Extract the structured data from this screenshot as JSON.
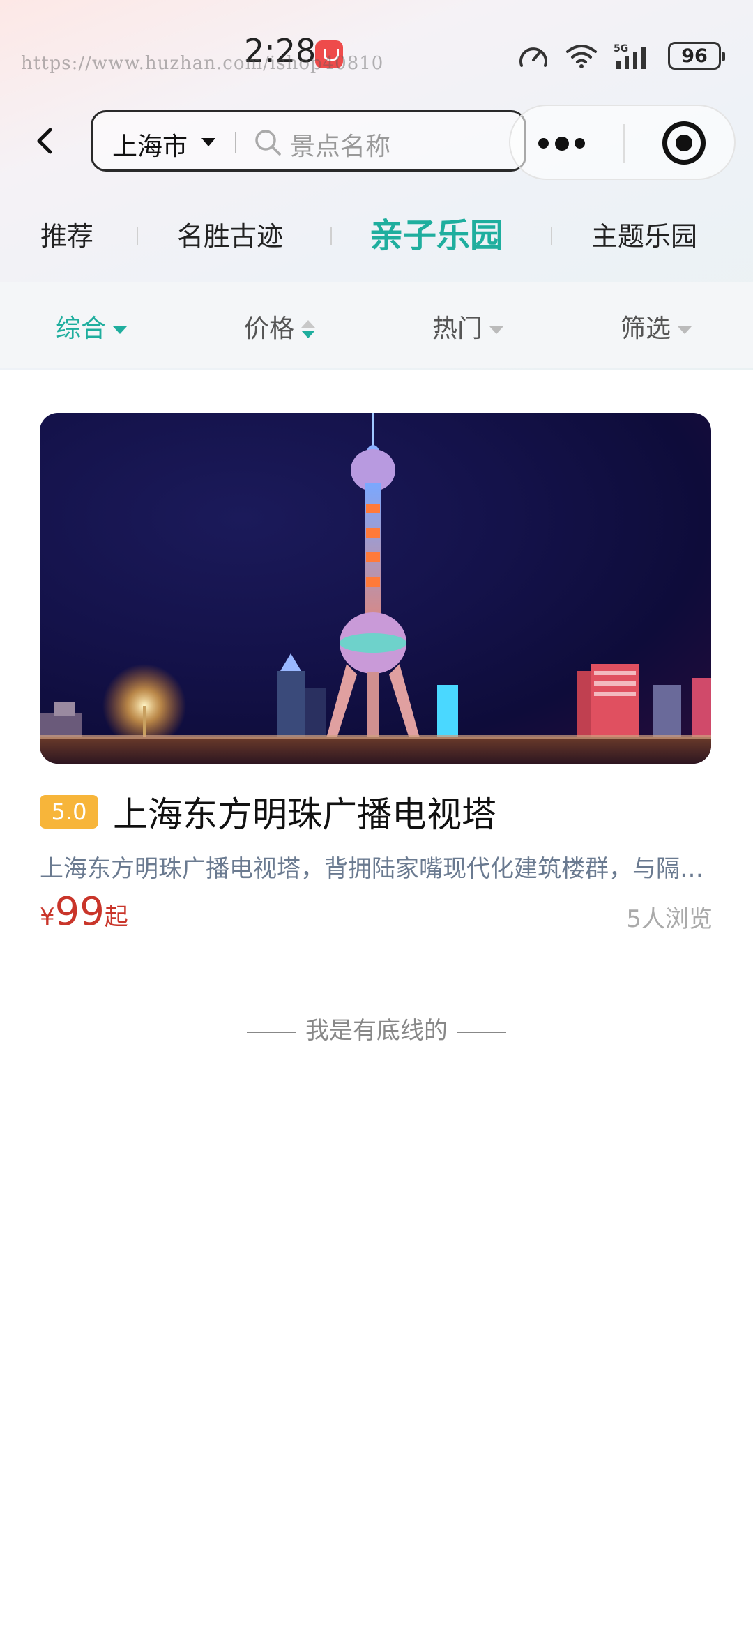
{
  "status_bar": {
    "time": "2:28",
    "battery": "96",
    "watermark": "https://www.huzhan.com/ishop40810"
  },
  "header": {
    "city": "上海市",
    "search_placeholder": "景点名称"
  },
  "categories": [
    {
      "label": "推荐",
      "active": false
    },
    {
      "label": "名胜古迹",
      "active": false
    },
    {
      "label": "亲子乐园",
      "active": true
    },
    {
      "label": "主题乐园",
      "active": false
    }
  ],
  "filters": [
    {
      "label": "综合",
      "active": true
    },
    {
      "label": "价格",
      "active": false
    },
    {
      "label": "热门",
      "active": false
    },
    {
      "label": "筛选",
      "active": false
    }
  ],
  "listing": {
    "rating": "5.0",
    "title": "上海东方明珠广播电视塔",
    "description": "上海东方明珠广播电视塔，背拥陆家嘴现代化建筑楼群，与隔江的外滩万国建筑博览群交相辉映",
    "price_currency": "¥",
    "price_value": "99",
    "price_suffix": "起",
    "views": "5人浏览"
  },
  "footer": {
    "end_text": "我是有底线的"
  },
  "colors": {
    "accent": "#1fae9e",
    "price": "#c9352a",
    "rating_badge": "#f7b53a"
  }
}
